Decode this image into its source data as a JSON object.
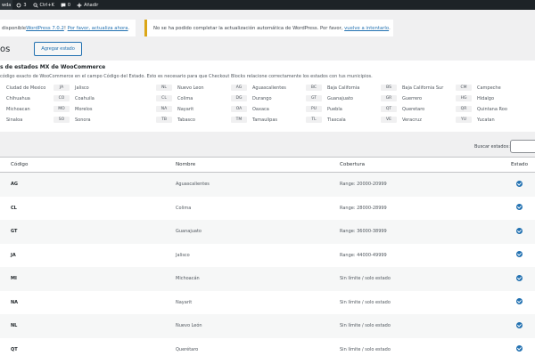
{
  "adminbar": {
    "first": "wda",
    "updates_count": "3",
    "shortcut": "Ctrl+K",
    "comments_count": "0",
    "new_label": "Añadir"
  },
  "notices": {
    "n1_text": "disponible ",
    "n1_link": "WordPress 7.0.2",
    "n1_mid": "! ",
    "n1_link2": "Por favor, actualiza ahora",
    "n1_end": ".",
    "n2_text": "No se ha podido completar la actualización automática de WordPress. Por favor, ",
    "n2_link": "vuelve a intentarlo",
    "n2_end": "."
  },
  "page": {
    "title": "os",
    "add_button": "Agregar estado"
  },
  "info": {
    "title": "s de estados MX de WooCommerce",
    "desc": "código exacto de WooCommerce en el campo Código del Estado. Esto es necesario para que Checkout Blocks relacione correctamente los estados con tus municipios.",
    "states": [
      {
        "pre": "Ciudad de Mexico",
        "code": "JA",
        "name": "Jalisco"
      },
      {
        "pre": "",
        "code": "NL",
        "name": "Nuevo Leon"
      },
      {
        "pre": "",
        "code": "AG",
        "name": "Aguascalientes"
      },
      {
        "pre": "",
        "code": "BC",
        "name": "Baja California"
      },
      {
        "pre": "",
        "code": "BS",
        "name": "Baja California Sur"
      },
      {
        "pre": "",
        "code": "CM",
        "name": "Campeche"
      },
      {
        "pre": "Chihuahua",
        "code": "CO",
        "name": "Coahuila"
      },
      {
        "pre": "",
        "code": "CL",
        "name": "Colima"
      },
      {
        "pre": "",
        "code": "DG",
        "name": "Durango"
      },
      {
        "pre": "",
        "code": "GT",
        "name": "Guanajuato"
      },
      {
        "pre": "",
        "code": "GR",
        "name": "Guerrero"
      },
      {
        "pre": "",
        "code": "HG",
        "name": "Hidalgo"
      },
      {
        "pre": "Michoacan",
        "code": "MO",
        "name": "Morelos"
      },
      {
        "pre": "",
        "code": "NA",
        "name": "Nayarit"
      },
      {
        "pre": "",
        "code": "OA",
        "name": "Oaxaca"
      },
      {
        "pre": "",
        "code": "PU",
        "name": "Puebla"
      },
      {
        "pre": "",
        "code": "QT",
        "name": "Queretaro"
      },
      {
        "pre": "",
        "code": "QR",
        "name": "Quintana Roo"
      },
      {
        "pre": "Sinaloa",
        "code": "SO",
        "name": "Sonora"
      },
      {
        "pre": "",
        "code": "TB",
        "name": "Tabasco"
      },
      {
        "pre": "",
        "code": "TM",
        "name": "Tamaulipas"
      },
      {
        "pre": "",
        "code": "TL",
        "name": "Tlaxcala"
      },
      {
        "pre": "",
        "code": "VE",
        "name": "Veracruz"
      },
      {
        "pre": "",
        "code": "YU",
        "name": "Yucatan"
      }
    ]
  },
  "search": {
    "label": "Buscar estados:",
    "value": ""
  },
  "table": {
    "headers": [
      "Código",
      "Nombre",
      "Cobertura",
      "Estado"
    ],
    "rows": [
      {
        "code": "AG",
        "name": "Aguascalientes",
        "coverage": "Range: 20000-20999"
      },
      {
        "code": "CL",
        "name": "Colima",
        "coverage": "Range: 28000-28999"
      },
      {
        "code": "GT",
        "name": "Guanajuato",
        "coverage": "Range: 36000-38999"
      },
      {
        "code": "JA",
        "name": "Jalisco",
        "coverage": "Range: 44000-49999"
      },
      {
        "code": "MI",
        "name": "Michoacán",
        "coverage": "Sin límite / solo estado"
      },
      {
        "code": "NA",
        "name": "Nayarit",
        "coverage": "Sin límite / solo estado"
      },
      {
        "code": "NL",
        "name": "Nuevo León",
        "coverage": "Sin límite / solo estado"
      },
      {
        "code": "QT",
        "name": "Querétaro",
        "coverage": "Sin límite / solo estado"
      }
    ]
  },
  "colors": {
    "accent": "#2271b1",
    "adminbar": "#1d2327",
    "notice_warning": "#dba617"
  }
}
